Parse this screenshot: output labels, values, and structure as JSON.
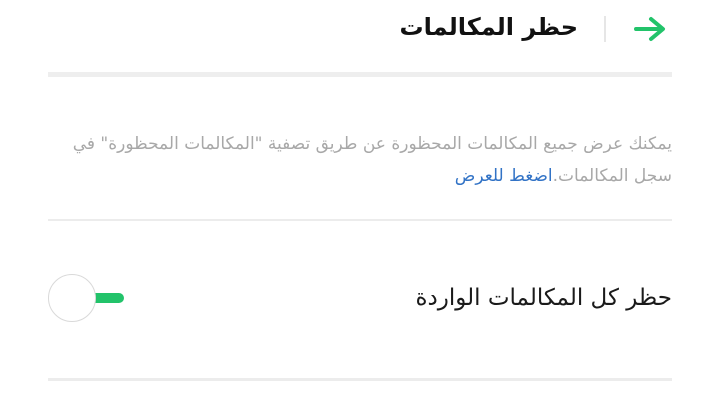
{
  "header": {
    "title": "حظر المكالمات",
    "back_icon": "arrow-back-icon"
  },
  "info": {
    "text": "يمكنك عرض جميع المكالمات المحظورة عن طريق تصفية \"المكالمات المحظورة\" في سجل المكالمات.",
    "link": "اضغط للعرض"
  },
  "settings": [
    {
      "label": "حظر كل المكالمات الواردة",
      "enabled": false
    }
  ],
  "colors": {
    "accent": "#22c36a",
    "link": "#3273c6",
    "secondary_text": "#a8a8a8"
  }
}
